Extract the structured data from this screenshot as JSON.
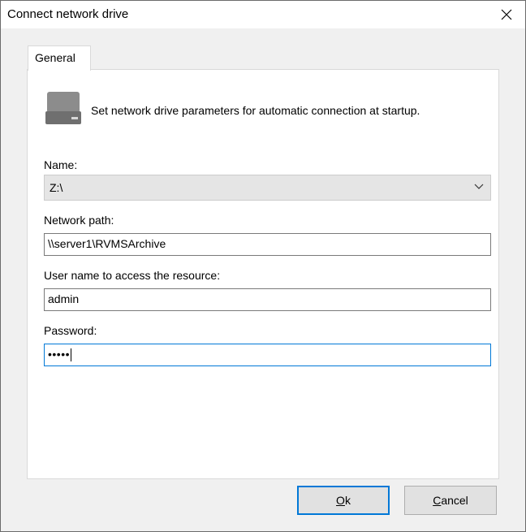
{
  "window": {
    "title": "Connect network drive"
  },
  "tabs": [
    {
      "label": "General"
    }
  ],
  "general": {
    "description": "Set network drive parameters for automatic connection at startup.",
    "name": {
      "label": "Name:",
      "value": "Z:\\"
    },
    "network_path": {
      "label": "Network path:",
      "value": "\\\\server1\\RVMSArchive"
    },
    "user_name": {
      "label": "User name to access the resource:",
      "value": "admin"
    },
    "password": {
      "label": "Password:",
      "value": "•••••"
    }
  },
  "buttons": {
    "ok": {
      "mnemonic": "O",
      "rest": "k"
    },
    "cancel": {
      "mnemonic": "C",
      "rest": "ancel"
    }
  },
  "icons": {
    "close": "close-icon",
    "drive": "drive-icon",
    "dropdown": "chevron-down-icon"
  },
  "colors": {
    "accent": "#0078d7",
    "window_bg": "#f0f0f0",
    "panel_bg": "#ffffff",
    "select_bg": "#e5e5e5"
  }
}
